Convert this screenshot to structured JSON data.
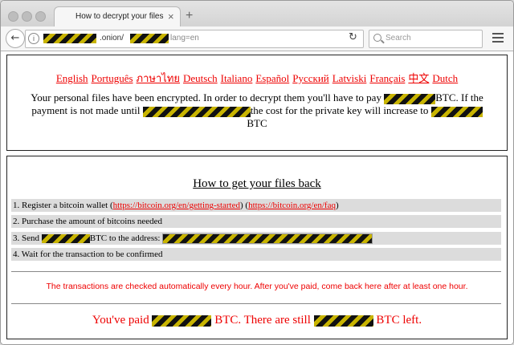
{
  "browser": {
    "tab_title": "How to decrypt your files",
    "tab_close": "×",
    "new_tab": "+",
    "url_host_suffix": ".onion/",
    "url_query": "lang=en",
    "search_placeholder": "Search"
  },
  "languages": [
    "English",
    "Português",
    "ภาษาไทย",
    "Deutsch",
    "Italiano",
    "Español",
    "Русский",
    "Latviski",
    "Français",
    "中文",
    "Dutch"
  ],
  "notice": {
    "part1": "Your personal files have been encrypted. In order to decrypt them you'll have to pay",
    "part2": "BTC. If the payment is not made until",
    "part3": "the cost for the private key will increase to",
    "part4": "BTC"
  },
  "howto": {
    "title": "How to get your files back",
    "step1_text": "1. Register a bitcoin wallet (",
    "step1_link1": "https://bitcoin.org/en/getting-started",
    "step1_mid": ") (",
    "step1_link2": "https://bitcoin.org/en/faq",
    "step1_end": ")",
    "step2": "2. Purchase the amount of bitcoins needed",
    "step3_a": "3. Send",
    "step3_b": "BTC to the address:",
    "step4": "4. Wait for the transaction to be confirmed"
  },
  "auto_check": "The transactions are checked automatically every hour. After you've paid, come back here after at least one hour.",
  "paid": {
    "part1": "You've paid",
    "part2": "BTC. There are still",
    "part3": "BTC left."
  }
}
